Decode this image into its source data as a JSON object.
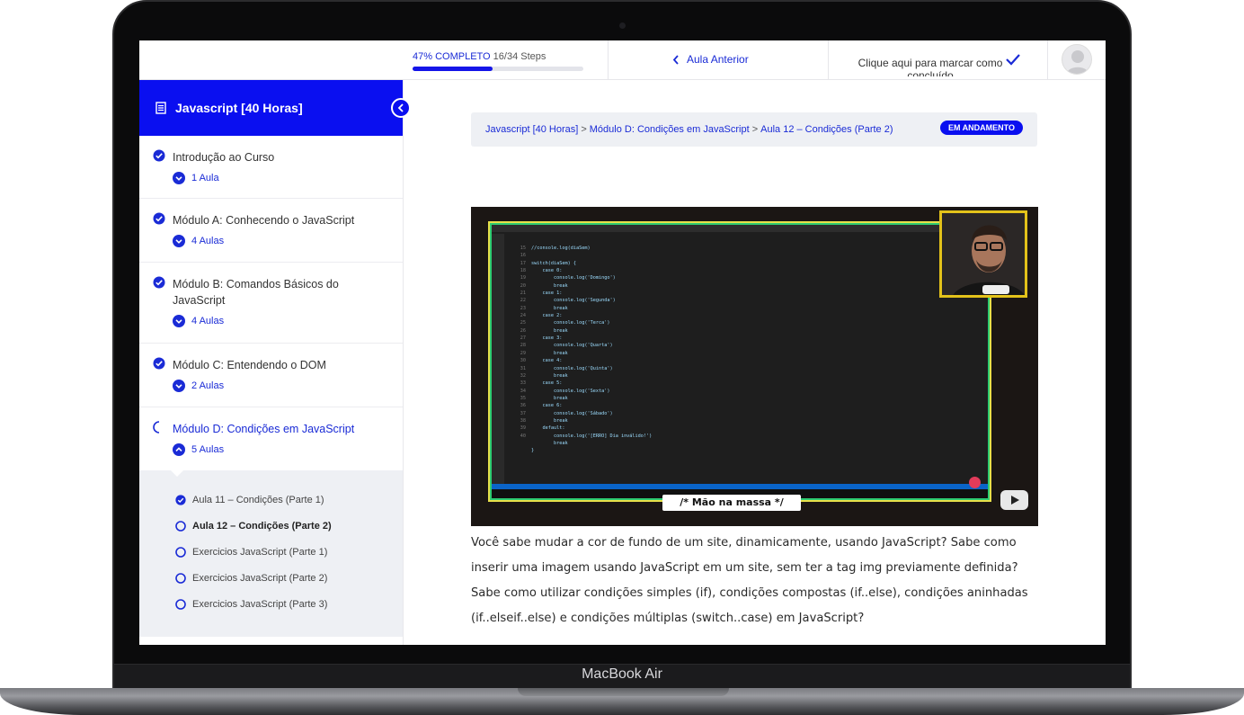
{
  "device": {
    "label": "MacBook Air"
  },
  "topbar": {
    "progress_label": "47% COMPLETO",
    "steps": "16/34 Steps",
    "progress_fraction": 0.47,
    "prev_label": "Aula Anterior",
    "mark_label": "Clique aqui para marcar como concluído"
  },
  "sidebar": {
    "course_title": "Javascript [40 Horas]",
    "modules": [
      {
        "title": "Introdução ao Curso",
        "lessons": "1 Aula"
      },
      {
        "title": "Módulo A: Conhecendo o JavaScript",
        "lessons": "4 Aulas"
      },
      {
        "title": "Módulo B: Comandos Básicos do JavaScript",
        "lessons": "4 Aulas"
      },
      {
        "title": "Módulo C: Entendendo o DOM",
        "lessons": "2 Aulas"
      },
      {
        "title": "Módulo D: Condições em JavaScript",
        "lessons": "5 Aulas"
      }
    ],
    "lesson_list": [
      {
        "title": "Aula 11 – Condições (Parte 1)",
        "done": true
      },
      {
        "title": "Aula 12 – Condições (Parte 2)",
        "done": false
      },
      {
        "title": "Exercicios JavaScript (Parte 1)",
        "done": false
      },
      {
        "title": "Exercicios JavaScript (Parte 2)",
        "done": false
      },
      {
        "title": "Exercicios JavaScript (Parte 3)",
        "done": false
      }
    ]
  },
  "breadcrumb": {
    "items": [
      "Javascript [40 Horas]",
      "Módulo D: Condições em JavaScript",
      "Aula 12 – Condições (Parte 2)"
    ],
    "separator": ">",
    "status": "EM ANDAMENTO"
  },
  "video": {
    "caption": "/* Mão na massa */",
    "code": "//console.log(diaSem)\n\nswitch(diaSem) {\n    case 0:\n        console.log('Domingo')\n        break\n    case 1:\n        console.log('Segunda')\n        break\n    case 2:\n        console.log('Terca')\n        break\n    case 3:\n        console.log('Quarta')\n        break\n    case 4:\n        console.log('Quinta')\n        break\n    case 5:\n        console.log('Sexta')\n        break\n    case 6:\n        console.log('Sábado')\n        break\n    default:\n        console.log('[ERRO] Dia inválido!')\n        break\n}",
    "line_numbers": "15\n16\n17\n18\n19\n20\n21\n22\n23\n24\n25\n26\n27\n28\n29\n30\n31\n32\n33\n34\n35\n36\n37\n38\n39\n40"
  },
  "description": "Você sabe mudar a cor de fundo de um site, dinamicamente, usando JavaScript? Sabe como inserir uma imagem usando JavaScript em um site, sem ter a tag img previamente definida? Sabe como utilizar condições simples (if), condições compostas (if..else), condições aninhadas (if..elseif..else) e condições múltiplas (switch..case) em JavaScript?",
  "colors": {
    "accent": "#0a0ff0",
    "link": "#1a2bd6"
  }
}
